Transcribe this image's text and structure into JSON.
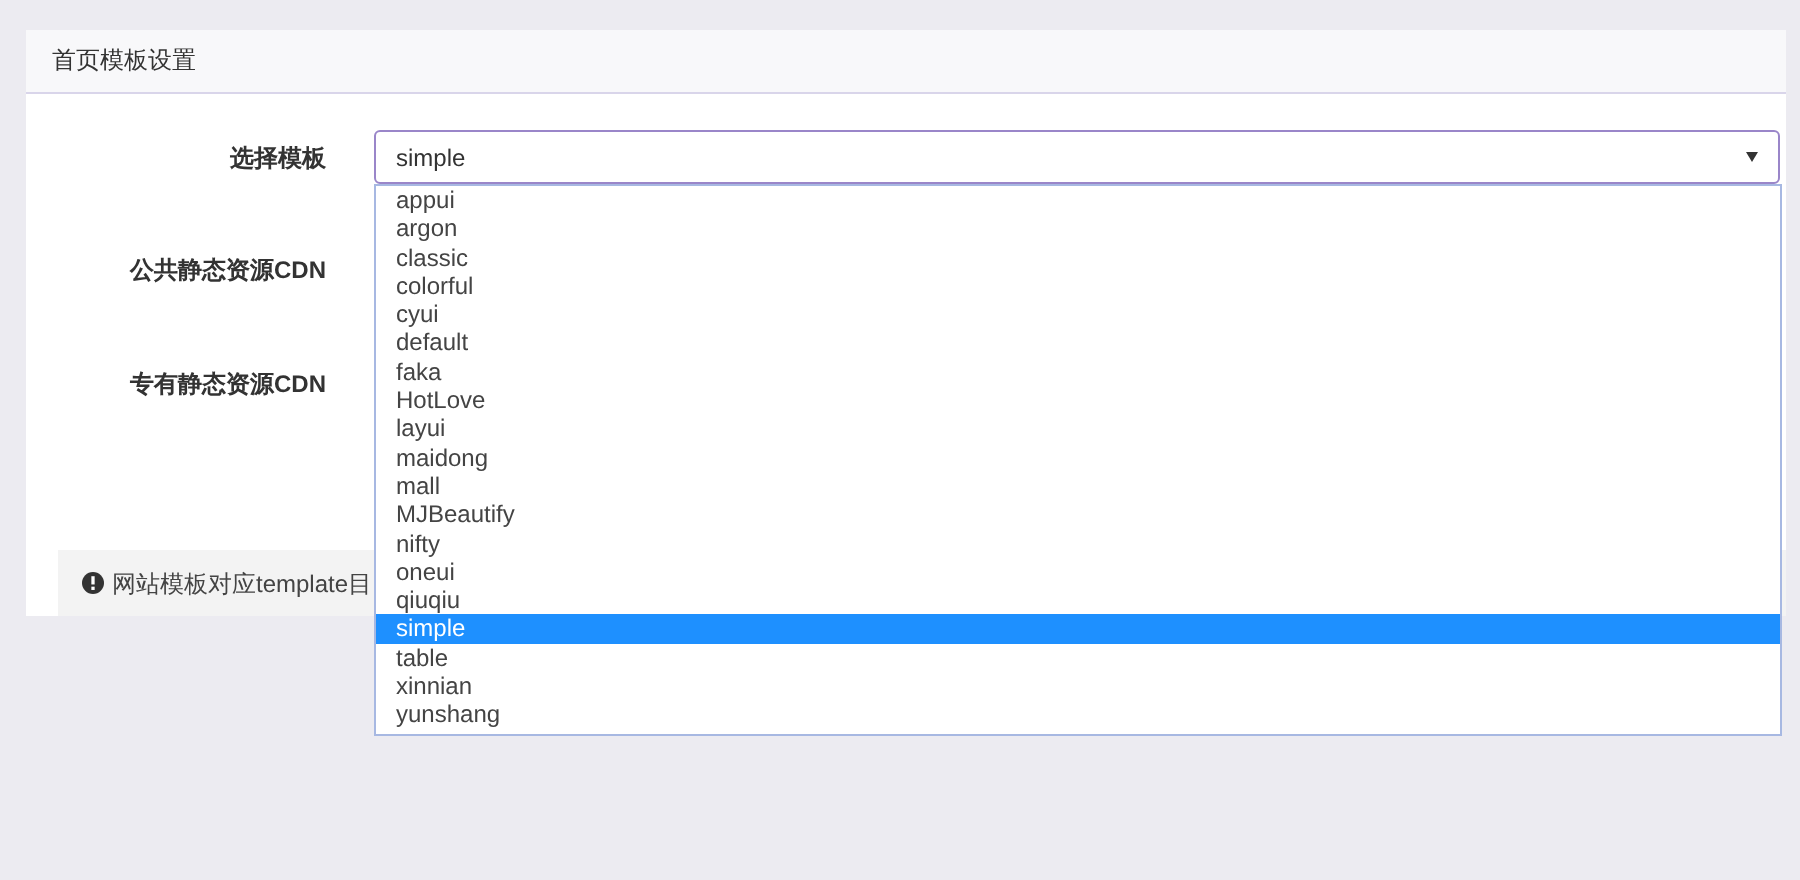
{
  "card": {
    "title": "首页模板设置"
  },
  "fields": [
    {
      "label": "选择模板",
      "kind": "select",
      "value": "simple"
    },
    {
      "label": "公共静态资源CDN",
      "kind": "blank"
    },
    {
      "label": "专有静态资源CDN",
      "kind": "blank"
    }
  ],
  "dropdown": {
    "options": [
      {
        "label": "appui",
        "selected": false
      },
      {
        "label": "argon",
        "selected": false
      },
      {
        "label": "classic",
        "selected": false
      },
      {
        "label": "colorful",
        "selected": false
      },
      {
        "label": "cyui",
        "selected": false
      },
      {
        "label": "default",
        "selected": false
      },
      {
        "label": "faka",
        "selected": false
      },
      {
        "label": "HotLove",
        "selected": false
      },
      {
        "label": "layui",
        "selected": false
      },
      {
        "label": "maidong",
        "selected": false
      },
      {
        "label": "mall",
        "selected": false
      },
      {
        "label": "MJBeautify",
        "selected": false
      },
      {
        "label": "nifty",
        "selected": false
      },
      {
        "label": "oneui",
        "selected": false
      },
      {
        "label": "qiuqiu",
        "selected": false
      },
      {
        "label": "simple",
        "selected": true
      },
      {
        "label": "table",
        "selected": false
      },
      {
        "label": "xinnian",
        "selected": false
      },
      {
        "label": "yunshang",
        "selected": false
      }
    ]
  },
  "footer": {
    "note": "网站模板对应template目"
  }
}
